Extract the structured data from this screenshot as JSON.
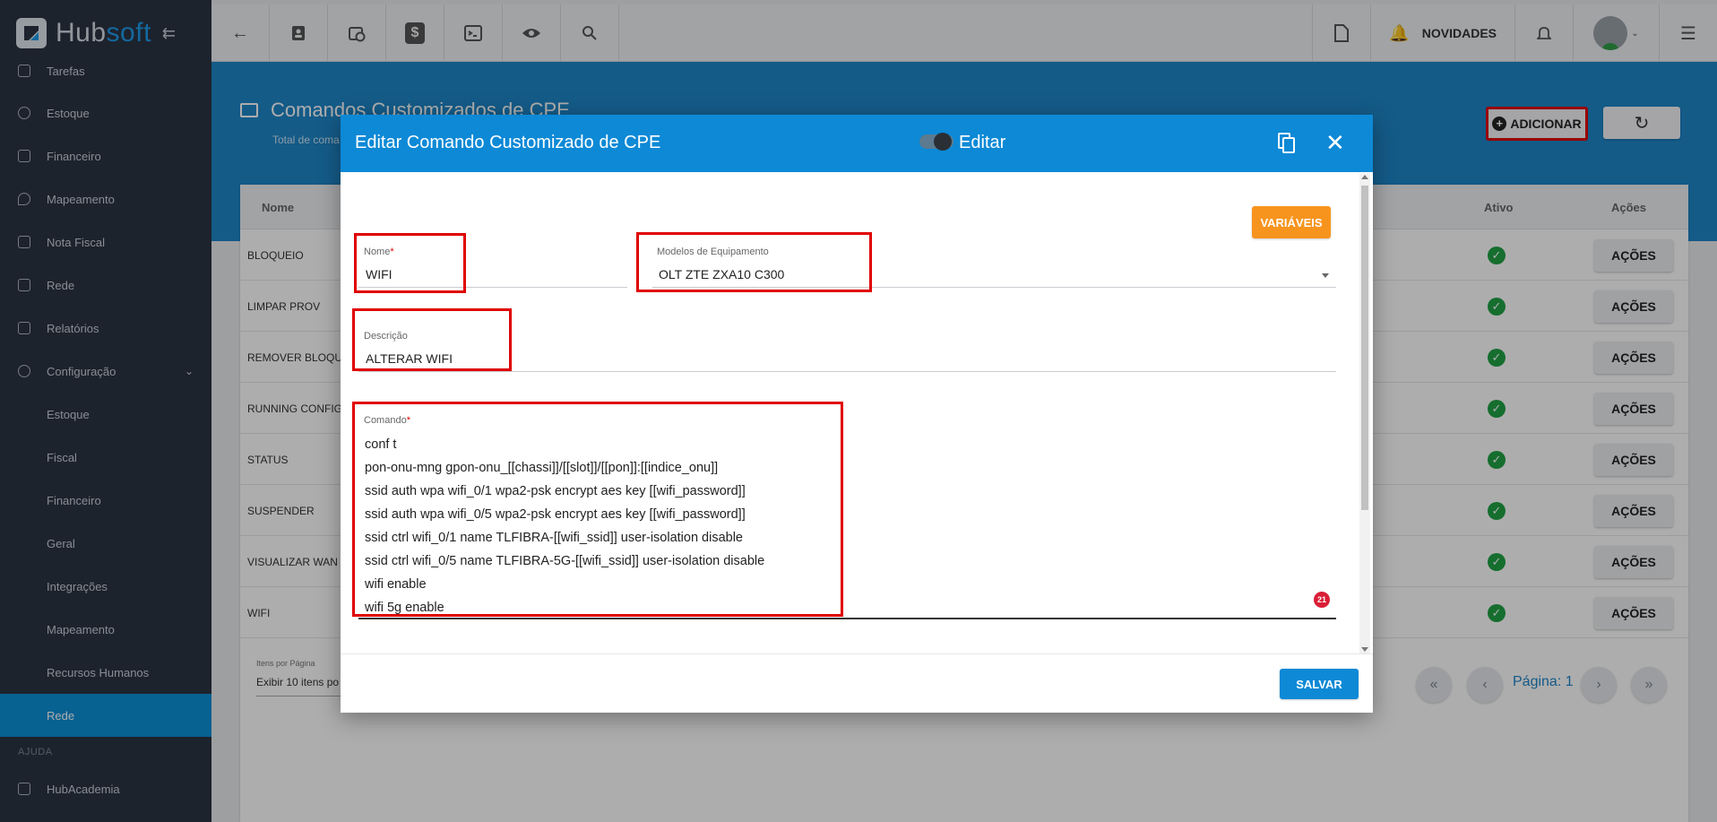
{
  "app": {
    "logo_part1": "Hub",
    "logo_part2": "soft",
    "novidades": "NOVIDADES"
  },
  "sidebar": {
    "items": [
      {
        "label": "Tarefas"
      },
      {
        "label": "Estoque"
      },
      {
        "label": "Financeiro"
      },
      {
        "label": "Mapeamento"
      },
      {
        "label": "Nota Fiscal"
      },
      {
        "label": "Rede"
      },
      {
        "label": "Relatórios"
      },
      {
        "label": "Configuração"
      }
    ],
    "subitems": [
      {
        "label": "Estoque"
      },
      {
        "label": "Fiscal"
      },
      {
        "label": "Financeiro"
      },
      {
        "label": "Geral"
      },
      {
        "label": "Integrações"
      },
      {
        "label": "Mapeamento"
      },
      {
        "label": "Recursos Humanos"
      },
      {
        "label": "Rede"
      }
    ],
    "section_ajuda": "AJUDA",
    "hubacademia": "HubAcademia"
  },
  "page": {
    "title": "Comandos Customizados de CPE",
    "subtitle": "Total de coma",
    "add_label": "ADICIONAR"
  },
  "table": {
    "col_nome": "Nome",
    "col_ativo": "Ativo",
    "col_acoes": "Ações",
    "rows": [
      {
        "name": "BLOQUEIO",
        "action": "AÇÕES"
      },
      {
        "name": "LIMPAR PROV",
        "action": "AÇÕES"
      },
      {
        "name": "REMOVER BLOQUEI",
        "action": "AÇÕES"
      },
      {
        "name": "RUNNING CONFIG",
        "action": "AÇÕES"
      },
      {
        "name": "STATUS",
        "action": "AÇÕES"
      },
      {
        "name": "SUSPENDER",
        "action": "AÇÕES"
      },
      {
        "name": "VISUALIZAR WAN",
        "action": "AÇÕES"
      },
      {
        "name": "WIFI",
        "action": "AÇÕES"
      }
    ],
    "items_per_page_label": "Itens por Página",
    "items_per_page_value": "Exibir 10 itens po",
    "page_label": "Página: 1"
  },
  "modal": {
    "title": "Editar Comando Customizado de CPE",
    "toggle_label": "Editar",
    "variables_button": "VARIÁVEIS",
    "nome_label": "Nome",
    "nome_required": "*",
    "nome_value": "WIFI",
    "modelos_label": "Modelos de Equipamento",
    "modelos_value": "OLT ZTE ZXA10 C300",
    "descricao_label": "Descrição",
    "descricao_value": "ALTERAR WIFI",
    "comando_label": "Comando",
    "comando_required": "*",
    "comando_lines": [
      "conf t",
      "pon-onu-mng gpon-onu_[[chassi]]/[[slot]]/[[pon]]:[[indice_onu]]",
      "ssid auth wpa wifi_0/1 wpa2-psk encrypt aes key [[wifi_password]]",
      "ssid auth wpa wifi_0/5 wpa2-psk encrypt aes key [[wifi_password]]",
      "ssid ctrl wifi_0/1 name TLFIBRA-[[wifi_ssid]] user-isolation disable",
      "ssid ctrl wifi_0/5 name TLFIBRA-5G-[[wifi_ssid]] user-isolation disable",
      "wifi enable",
      "wifi 5g enable"
    ],
    "badge_count": "21",
    "save_button": "SALVAR"
  },
  "colors": {
    "primary": "#0d89d6",
    "header_band": "#1e86c9",
    "sidebar": "#2b3443",
    "warning": "#f7941d",
    "success": "#1fa245",
    "highlight": "#e00000"
  }
}
